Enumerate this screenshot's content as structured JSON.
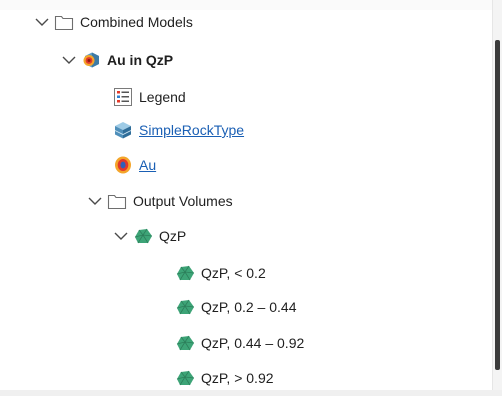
{
  "tree": {
    "combined_models": {
      "label": "Combined Models",
      "icon": "folder-icon",
      "expanded": true
    },
    "au_in_qzp": {
      "label": "Au in QzP",
      "icon": "combined-model-icon",
      "expanded": true
    },
    "legend": {
      "label": "Legend",
      "icon": "legend-icon"
    },
    "simple_rock_type": {
      "label": "SimpleRockType",
      "icon": "geological-model-icon"
    },
    "au": {
      "label": "Au",
      "icon": "numeric-model-icon"
    },
    "output_volumes": {
      "label": "Output Volumes",
      "icon": "folder-icon",
      "expanded": true
    },
    "qzp": {
      "label": "QzP",
      "icon": "volume-icon",
      "expanded": true
    },
    "volumes": [
      {
        "label": "QzP, < 0.2",
        "icon": "volume-icon"
      },
      {
        "label": "QzP, 0.2 – 0.44",
        "icon": "volume-icon"
      },
      {
        "label": "QzP, 0.44 – 0.92",
        "icon": "volume-icon"
      },
      {
        "label": "QzP, > 0.92",
        "icon": "volume-icon"
      }
    ]
  },
  "colors": {
    "text": "#1f1f1f",
    "link": "#1a5fb4",
    "volume_green": "#3da477",
    "chevron": "#4a4a4a",
    "folder_stroke": "#6e6e6e"
  }
}
